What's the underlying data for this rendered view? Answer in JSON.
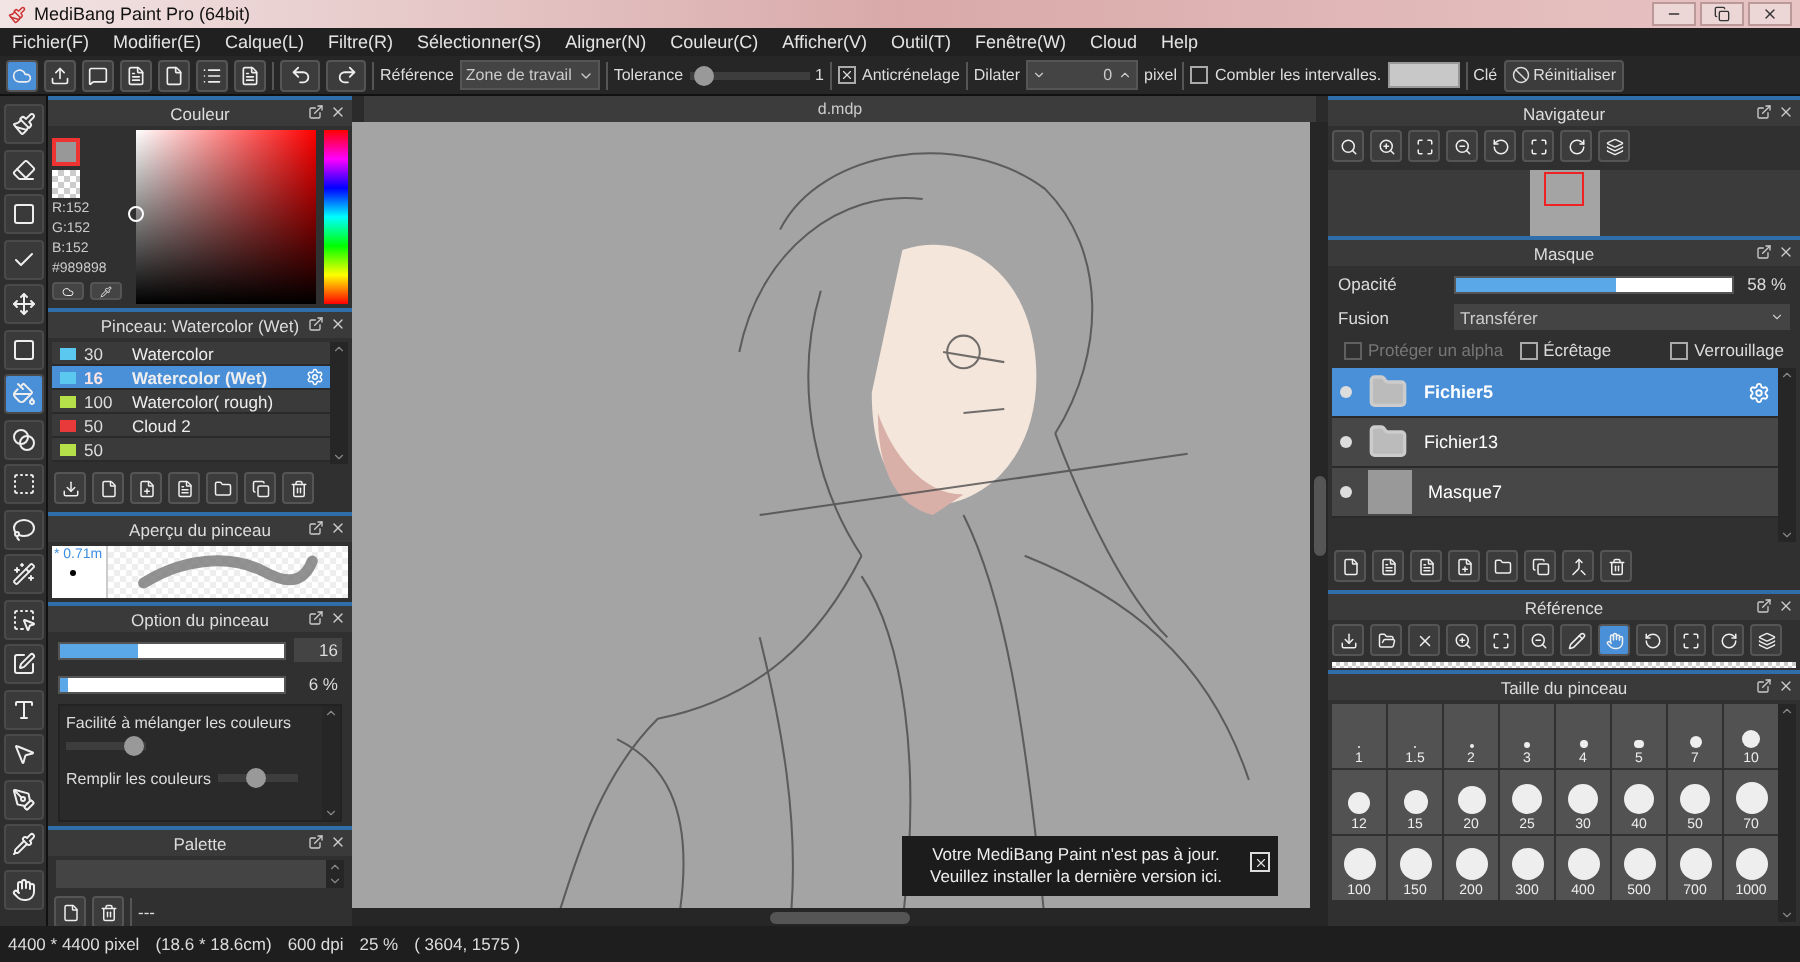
{
  "window": {
    "title": "MediBang Paint Pro (64bit)"
  },
  "menu": [
    "Fichier(F)",
    "Modifier(E)",
    "Calque(L)",
    "Filtre(R)",
    "Sélectionner(S)",
    "Aligner(N)",
    "Couleur(C)",
    "Afficher(V)",
    "Outil(T)",
    "Fenêtre(W)",
    "Cloud",
    "Help"
  ],
  "toolbar": {
    "reference_label": "Référence",
    "reference_value": "Zone de travail",
    "tolerance_label": "Tolerance",
    "tolerance": {
      "level": 0.04,
      "value": "1"
    },
    "antialias": {
      "label": "Anticrénelage",
      "checked": true
    },
    "dilate_label": "Dilater",
    "dilate_value": "0",
    "dilate_unit": "pixel",
    "fill_gaps": {
      "label": "Combler les intervalles.",
      "checked": false
    },
    "key_label": "Clé",
    "reset": "Réinitialiser"
  },
  "tools": [
    {
      "selected": false
    },
    {
      "selected": false
    },
    {
      "selected": false
    },
    {
      "selected": false
    },
    {
      "selected": false
    },
    {
      "selected": false
    },
    {
      "selected": true
    },
    {
      "selected": false
    },
    {
      "selected": false
    },
    {
      "selected": false
    },
    {
      "selected": false
    },
    {
      "selected": false
    },
    {
      "selected": false
    },
    {
      "selected": false
    },
    {
      "selected": false
    },
    {
      "selected": false
    },
    {
      "selected": false
    },
    {
      "selected": false
    }
  ],
  "color_panel": {
    "title": "Couleur",
    "rgb": [
      "R:152",
      "G:152",
      "B:152"
    ],
    "hex": "#989898"
  },
  "brush_panel": {
    "title": "Pinceau: Watercolor (Wet)",
    "brushes": [
      {
        "size": "30",
        "name": "Watercolor",
        "color": "#5bc8f0",
        "selected": false
      },
      {
        "size": "16",
        "name": "Watercolor (Wet)",
        "color": "#5bc8f0",
        "selected": true
      },
      {
        "size": "100",
        "name": "Watercolor( rough)",
        "color": "#b5e04a",
        "selected": false
      },
      {
        "size": "50",
        "name": "Cloud 2",
        "color": "#e83a3a",
        "selected": false
      },
      {
        "size": "50",
        "color": "#b5e04a",
        "selected": false
      }
    ]
  },
  "preview_panel": {
    "title": "Aperçu du pinceau",
    "size": "* 0.71m"
  },
  "option_panel": {
    "title": "Option du pinceau",
    "size": {
      "level": 0.35,
      "value": "16"
    },
    "opacity": {
      "level": 0.04,
      "value": "6 %"
    },
    "options": [
      {
        "label": "Facilité à mélanger les couleurs",
        "level": 0.95
      },
      {
        "label": "Remplir les couleurs",
        "level": 0.45
      }
    ]
  },
  "palette_panel": {
    "title": "Palette",
    "status": "---"
  },
  "canvas": {
    "tab": "d.mdp",
    "notice": "Votre MediBang Paint n'est pas à jour. Veuillez installer la dernière version ici."
  },
  "navigator": {
    "title": "Navigateur"
  },
  "layers": {
    "title": "Masque",
    "opacity_label": "Opacité",
    "opacity": {
      "level": 0.58,
      "value": "58 %"
    },
    "blend_label": "Fusion",
    "blend_value": "Transférer",
    "checks": [
      {
        "label": "Protéger un alpha",
        "checked": false,
        "disabled": true
      },
      {
        "label": "Écrêtage",
        "checked": false,
        "disabled": false
      },
      {
        "label": "Verrouillage",
        "checked": false,
        "disabled": false
      }
    ],
    "items": [
      {
        "name": "Fichier5",
        "kind": "folder",
        "selected": true
      },
      {
        "name": "Fichier13",
        "kind": "folder",
        "selected": false
      },
      {
        "name": "Masque7",
        "kind": "layer",
        "selected": false
      }
    ]
  },
  "reference": {
    "title": "Référence"
  },
  "brush_sizes": {
    "title": "Taille du pinceau",
    "sizes": [
      "1",
      "1.5",
      "2",
      "3",
      "4",
      "5",
      "7",
      "10",
      "12",
      "15",
      "20",
      "25",
      "30",
      "40",
      "50",
      "70",
      "100",
      "150",
      "200",
      "300",
      "400",
      "500",
      "700",
      "1000"
    ]
  },
  "status_bar": [
    "4400 * 4400 pixel",
    "(18.6 * 18.6cm)",
    "600 dpi",
    "25 %",
    "( 3604, 1575 )"
  ]
}
